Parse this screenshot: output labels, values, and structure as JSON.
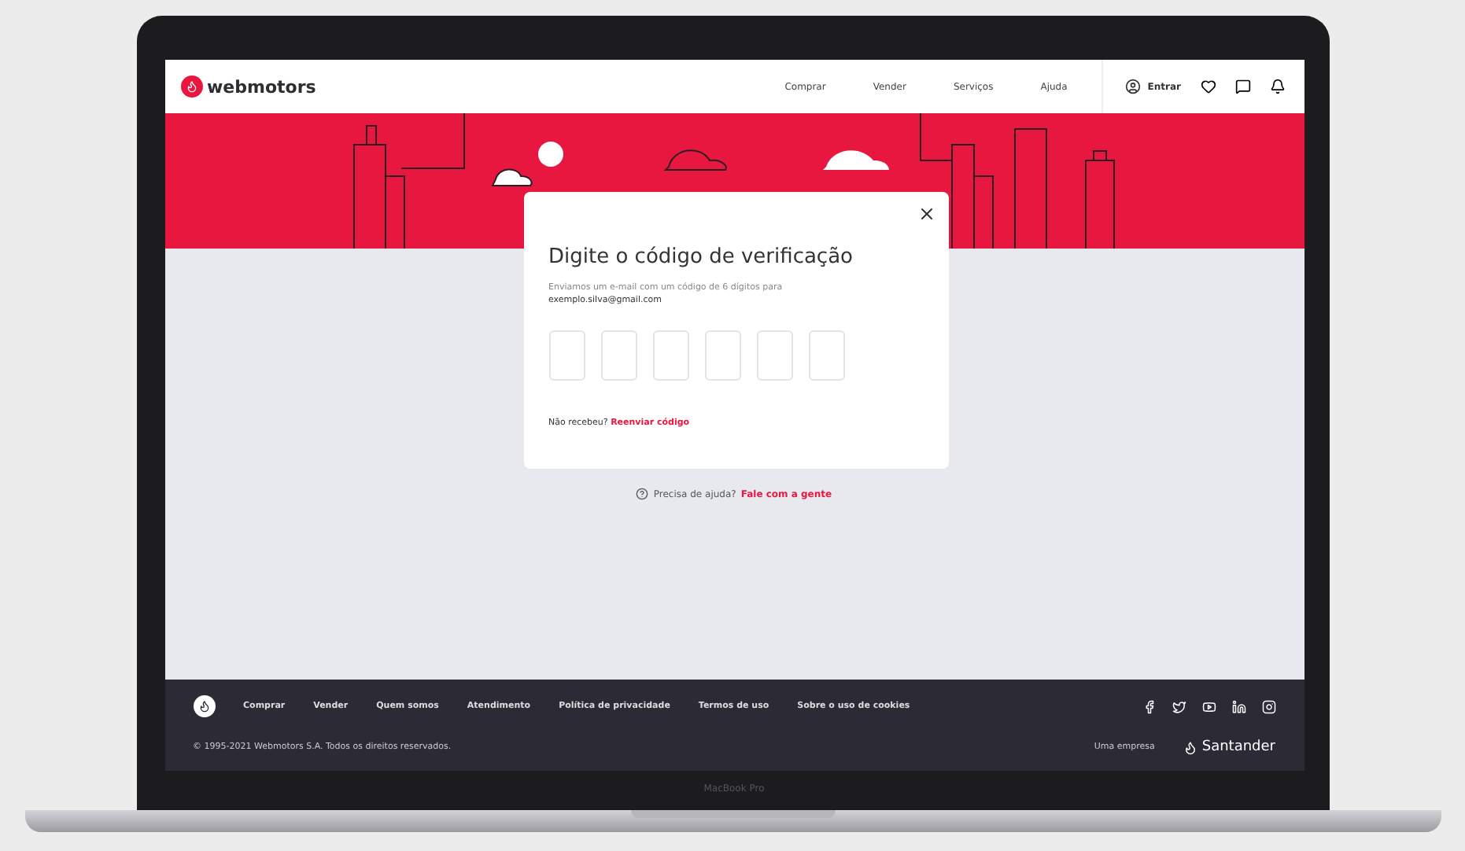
{
  "header": {
    "logo": "webmotors",
    "nav": [
      "Comprar",
      "Vender",
      "Serviços",
      "Ajuda"
    ],
    "login": "Entrar"
  },
  "modal": {
    "title": "Digite o código de verificação",
    "message": "Enviamos um e-mail com um código de 6 dígitos para",
    "email": "exemplo.silva@gmail.com",
    "code_fields": [
      {
        "filled": false
      },
      {
        "filled": false
      },
      {
        "filled": false
      },
      {
        "filled": false
      },
      {
        "filled": false
      },
      {
        "filled": false
      }
    ],
    "resend_prompt": "Não recebeu?",
    "resend_link": "Reenviar código"
  },
  "help": {
    "prompt": "Precisa de ajuda?",
    "link": "Fale com a gente"
  },
  "footer": {
    "links": [
      "Comprar",
      "Vender",
      "Quem somos",
      "Atendimento",
      "Política de privacidade",
      "Termos de uso",
      "Sobre o uso de cookies"
    ],
    "copyright": "© 1995-2021 Webmotors S.A. Todos os direitos reservados.",
    "company_label": "Uma empresa",
    "company": "Santander"
  },
  "device_label": "MacBook Pro"
}
